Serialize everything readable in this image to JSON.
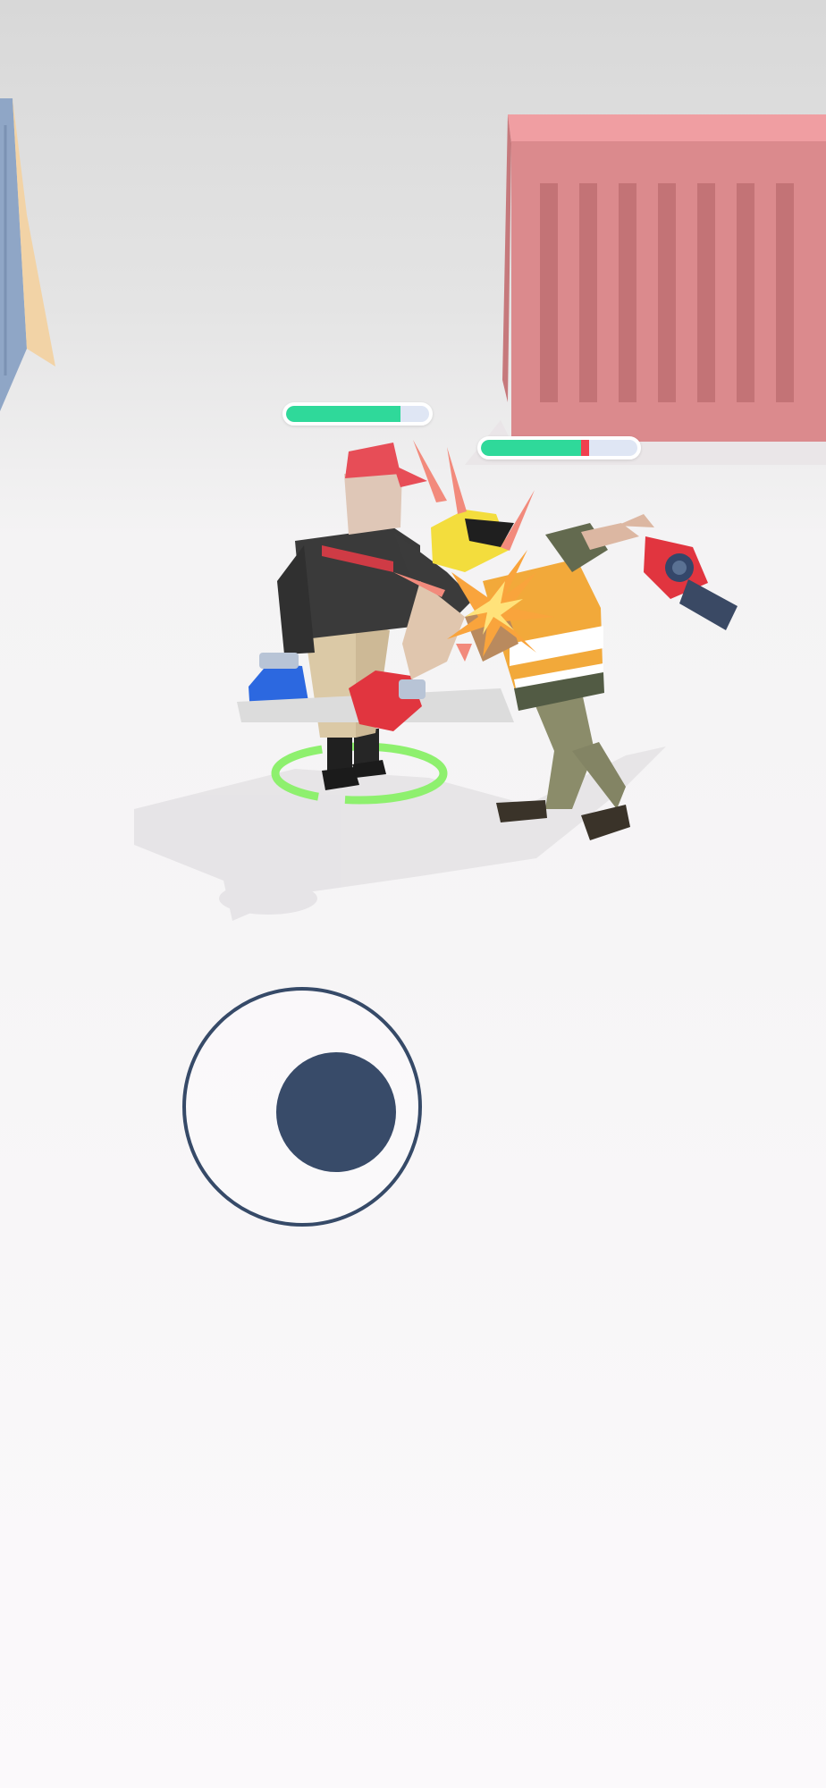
{
  "game": {
    "player": {
      "health_fraction": 0.8,
      "bar_color": "#2fd99a",
      "bar_empty_color": "#dfe6f4"
    },
    "enemy": {
      "health_fraction": 0.64,
      "damage_fraction": 0.05,
      "bar_color": "#2fd99a",
      "damage_color": "#f0404e",
      "bar_empty_color": "#dfe6f4"
    },
    "joystick": {
      "ring_color": "#364a68",
      "knob_color": "#384b69"
    },
    "scene": {
      "background_color": "#f6f4f7",
      "container_color": "#db8a8d",
      "ground_color": "#fbfafb",
      "target_ring_color": "#8ef06e"
    }
  }
}
